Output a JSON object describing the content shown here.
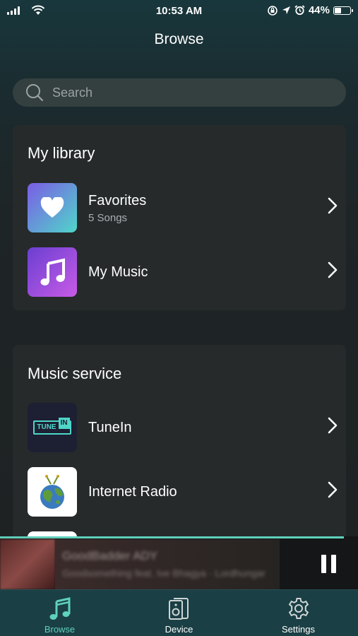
{
  "status_bar": {
    "time": "10:53 AM",
    "battery": "44%",
    "battery_level": 0.44,
    "icons": [
      "signal-icon",
      "wifi-icon",
      "rotation-lock-icon",
      "location-icon",
      "alarm-icon",
      "battery-icon"
    ]
  },
  "header": {
    "title": "Browse"
  },
  "search": {
    "placeholder": "Search"
  },
  "library": {
    "title": "My library",
    "items": [
      {
        "label": "Favorites",
        "subtitle": "5 Songs",
        "icon": "heart-icon"
      },
      {
        "label": "My Music",
        "icon": "music-note-icon"
      }
    ]
  },
  "music_service": {
    "title": "Music service",
    "items": [
      {
        "label": "TuneIn",
        "logo_text_left": "TUNE",
        "logo_text_right": "IN",
        "icon": "tunein-logo"
      },
      {
        "label": "Internet Radio",
        "icon": "globe-radio-icon"
      }
    ]
  },
  "now_playing": {
    "title": "GoodBadder ADY",
    "artist": "Goodsomething feat. Ive Bhagya · Lordhungar",
    "progress": 0.96,
    "control": "pause-icon"
  },
  "tab_bar": {
    "tabs": [
      {
        "label": "Browse",
        "icon": "music-note-icon",
        "active": true
      },
      {
        "label": "Device",
        "icon": "speaker-icon",
        "active": false
      },
      {
        "label": "Settings",
        "icon": "gear-icon",
        "active": false
      }
    ]
  },
  "colors": {
    "accent": "#5fd1bd",
    "card": "#262a2b",
    "tab_bar": "#1a3f45",
    "favorites_gradient": [
      "#7b5ce6",
      "#4fd6c9"
    ],
    "music_gradient": [
      "#6a3fd1",
      "#c85be6"
    ]
  }
}
